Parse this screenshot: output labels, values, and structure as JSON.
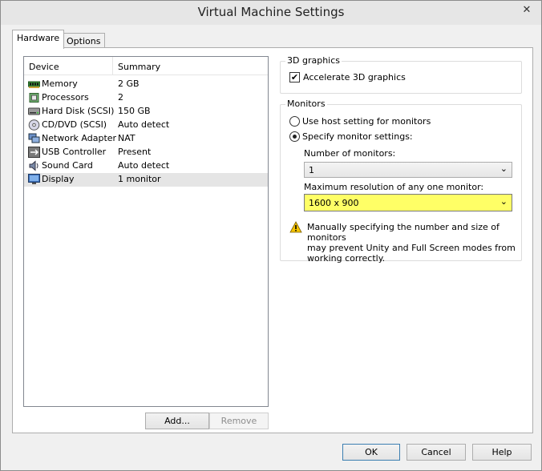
{
  "window": {
    "title": "Virtual Machine Settings",
    "close_glyph": "✕"
  },
  "tabs": [
    {
      "label": "Hardware",
      "active": true
    },
    {
      "label": "Options",
      "active": false
    }
  ],
  "device_list": {
    "headers": {
      "device": "Device",
      "summary": "Summary"
    },
    "rows": [
      {
        "device": "Memory",
        "summary": "2 GB",
        "icon": "memory-icon"
      },
      {
        "device": "Processors",
        "summary": "2",
        "icon": "processor-icon"
      },
      {
        "device": "Hard Disk (SCSI)",
        "summary": "150 GB",
        "icon": "hard-disk-icon"
      },
      {
        "device": "CD/DVD (SCSI)",
        "summary": "Auto detect",
        "icon": "cd-dvd-icon"
      },
      {
        "device": "Network Adapter",
        "summary": "NAT",
        "icon": "network-adapter-icon"
      },
      {
        "device": "USB Controller",
        "summary": "Present",
        "icon": "usb-icon"
      },
      {
        "device": "Sound Card",
        "summary": "Auto detect",
        "icon": "sound-card-icon"
      },
      {
        "device": "Display",
        "summary": "1 monitor",
        "icon": "display-icon",
        "selected": true
      }
    ]
  },
  "list_buttons": {
    "add": "Add...",
    "remove": "Remove"
  },
  "graphics": {
    "group_label": "3D graphics",
    "accelerate_label": "Accelerate 3D graphics",
    "accelerate_checked": true,
    "check_glyph": "✔"
  },
  "monitors": {
    "group_label": "Monitors",
    "use_host_label": "Use host setting for monitors",
    "specify_label": "Specify monitor settings:",
    "selected_option": "specify",
    "number_label": "Number of monitors:",
    "number_value": "1",
    "resolution_label": "Maximum resolution of any one monitor:",
    "resolution_value": "1600 x 900",
    "chevron_glyph": "⌄",
    "warning_line1": "Manually specifying the number and size of monitors",
    "warning_line2": "may prevent Unity and Full Screen modes from",
    "warning_line3": "working correctly."
  },
  "dialog_buttons": {
    "ok": "OK",
    "cancel": "Cancel",
    "help": "Help"
  },
  "colors": {
    "highlight": "#ffff66",
    "warning": "#f5c400"
  }
}
